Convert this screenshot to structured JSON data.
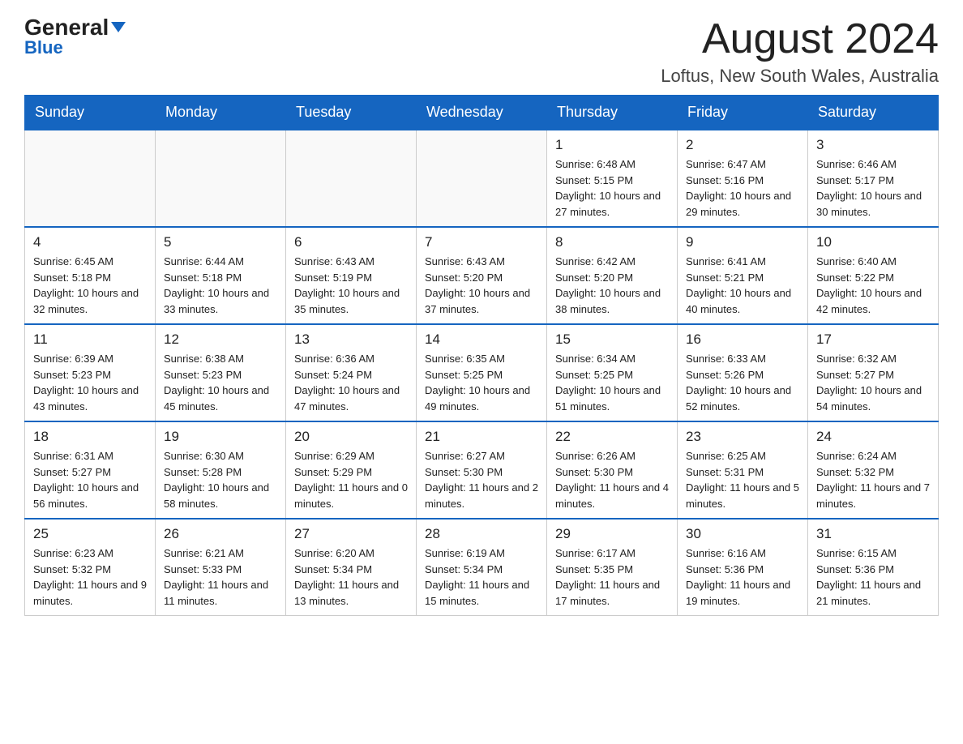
{
  "logo": {
    "general": "General",
    "blue": "Blue"
  },
  "header": {
    "month_year": "August 2024",
    "location": "Loftus, New South Wales, Australia"
  },
  "days_of_week": [
    "Sunday",
    "Monday",
    "Tuesday",
    "Wednesday",
    "Thursday",
    "Friday",
    "Saturday"
  ],
  "weeks": [
    [
      {
        "day": "",
        "info": ""
      },
      {
        "day": "",
        "info": ""
      },
      {
        "day": "",
        "info": ""
      },
      {
        "day": "",
        "info": ""
      },
      {
        "day": "1",
        "info": "Sunrise: 6:48 AM\nSunset: 5:15 PM\nDaylight: 10 hours and 27 minutes."
      },
      {
        "day": "2",
        "info": "Sunrise: 6:47 AM\nSunset: 5:16 PM\nDaylight: 10 hours and 29 minutes."
      },
      {
        "day": "3",
        "info": "Sunrise: 6:46 AM\nSunset: 5:17 PM\nDaylight: 10 hours and 30 minutes."
      }
    ],
    [
      {
        "day": "4",
        "info": "Sunrise: 6:45 AM\nSunset: 5:18 PM\nDaylight: 10 hours and 32 minutes."
      },
      {
        "day": "5",
        "info": "Sunrise: 6:44 AM\nSunset: 5:18 PM\nDaylight: 10 hours and 33 minutes."
      },
      {
        "day": "6",
        "info": "Sunrise: 6:43 AM\nSunset: 5:19 PM\nDaylight: 10 hours and 35 minutes."
      },
      {
        "day": "7",
        "info": "Sunrise: 6:43 AM\nSunset: 5:20 PM\nDaylight: 10 hours and 37 minutes."
      },
      {
        "day": "8",
        "info": "Sunrise: 6:42 AM\nSunset: 5:20 PM\nDaylight: 10 hours and 38 minutes."
      },
      {
        "day": "9",
        "info": "Sunrise: 6:41 AM\nSunset: 5:21 PM\nDaylight: 10 hours and 40 minutes."
      },
      {
        "day": "10",
        "info": "Sunrise: 6:40 AM\nSunset: 5:22 PM\nDaylight: 10 hours and 42 minutes."
      }
    ],
    [
      {
        "day": "11",
        "info": "Sunrise: 6:39 AM\nSunset: 5:23 PM\nDaylight: 10 hours and 43 minutes."
      },
      {
        "day": "12",
        "info": "Sunrise: 6:38 AM\nSunset: 5:23 PM\nDaylight: 10 hours and 45 minutes."
      },
      {
        "day": "13",
        "info": "Sunrise: 6:36 AM\nSunset: 5:24 PM\nDaylight: 10 hours and 47 minutes."
      },
      {
        "day": "14",
        "info": "Sunrise: 6:35 AM\nSunset: 5:25 PM\nDaylight: 10 hours and 49 minutes."
      },
      {
        "day": "15",
        "info": "Sunrise: 6:34 AM\nSunset: 5:25 PM\nDaylight: 10 hours and 51 minutes."
      },
      {
        "day": "16",
        "info": "Sunrise: 6:33 AM\nSunset: 5:26 PM\nDaylight: 10 hours and 52 minutes."
      },
      {
        "day": "17",
        "info": "Sunrise: 6:32 AM\nSunset: 5:27 PM\nDaylight: 10 hours and 54 minutes."
      }
    ],
    [
      {
        "day": "18",
        "info": "Sunrise: 6:31 AM\nSunset: 5:27 PM\nDaylight: 10 hours and 56 minutes."
      },
      {
        "day": "19",
        "info": "Sunrise: 6:30 AM\nSunset: 5:28 PM\nDaylight: 10 hours and 58 minutes."
      },
      {
        "day": "20",
        "info": "Sunrise: 6:29 AM\nSunset: 5:29 PM\nDaylight: 11 hours and 0 minutes."
      },
      {
        "day": "21",
        "info": "Sunrise: 6:27 AM\nSunset: 5:30 PM\nDaylight: 11 hours and 2 minutes."
      },
      {
        "day": "22",
        "info": "Sunrise: 6:26 AM\nSunset: 5:30 PM\nDaylight: 11 hours and 4 minutes."
      },
      {
        "day": "23",
        "info": "Sunrise: 6:25 AM\nSunset: 5:31 PM\nDaylight: 11 hours and 5 minutes."
      },
      {
        "day": "24",
        "info": "Sunrise: 6:24 AM\nSunset: 5:32 PM\nDaylight: 11 hours and 7 minutes."
      }
    ],
    [
      {
        "day": "25",
        "info": "Sunrise: 6:23 AM\nSunset: 5:32 PM\nDaylight: 11 hours and 9 minutes."
      },
      {
        "day": "26",
        "info": "Sunrise: 6:21 AM\nSunset: 5:33 PM\nDaylight: 11 hours and 11 minutes."
      },
      {
        "day": "27",
        "info": "Sunrise: 6:20 AM\nSunset: 5:34 PM\nDaylight: 11 hours and 13 minutes."
      },
      {
        "day": "28",
        "info": "Sunrise: 6:19 AM\nSunset: 5:34 PM\nDaylight: 11 hours and 15 minutes."
      },
      {
        "day": "29",
        "info": "Sunrise: 6:17 AM\nSunset: 5:35 PM\nDaylight: 11 hours and 17 minutes."
      },
      {
        "day": "30",
        "info": "Sunrise: 6:16 AM\nSunset: 5:36 PM\nDaylight: 11 hours and 19 minutes."
      },
      {
        "day": "31",
        "info": "Sunrise: 6:15 AM\nSunset: 5:36 PM\nDaylight: 11 hours and 21 minutes."
      }
    ]
  ]
}
